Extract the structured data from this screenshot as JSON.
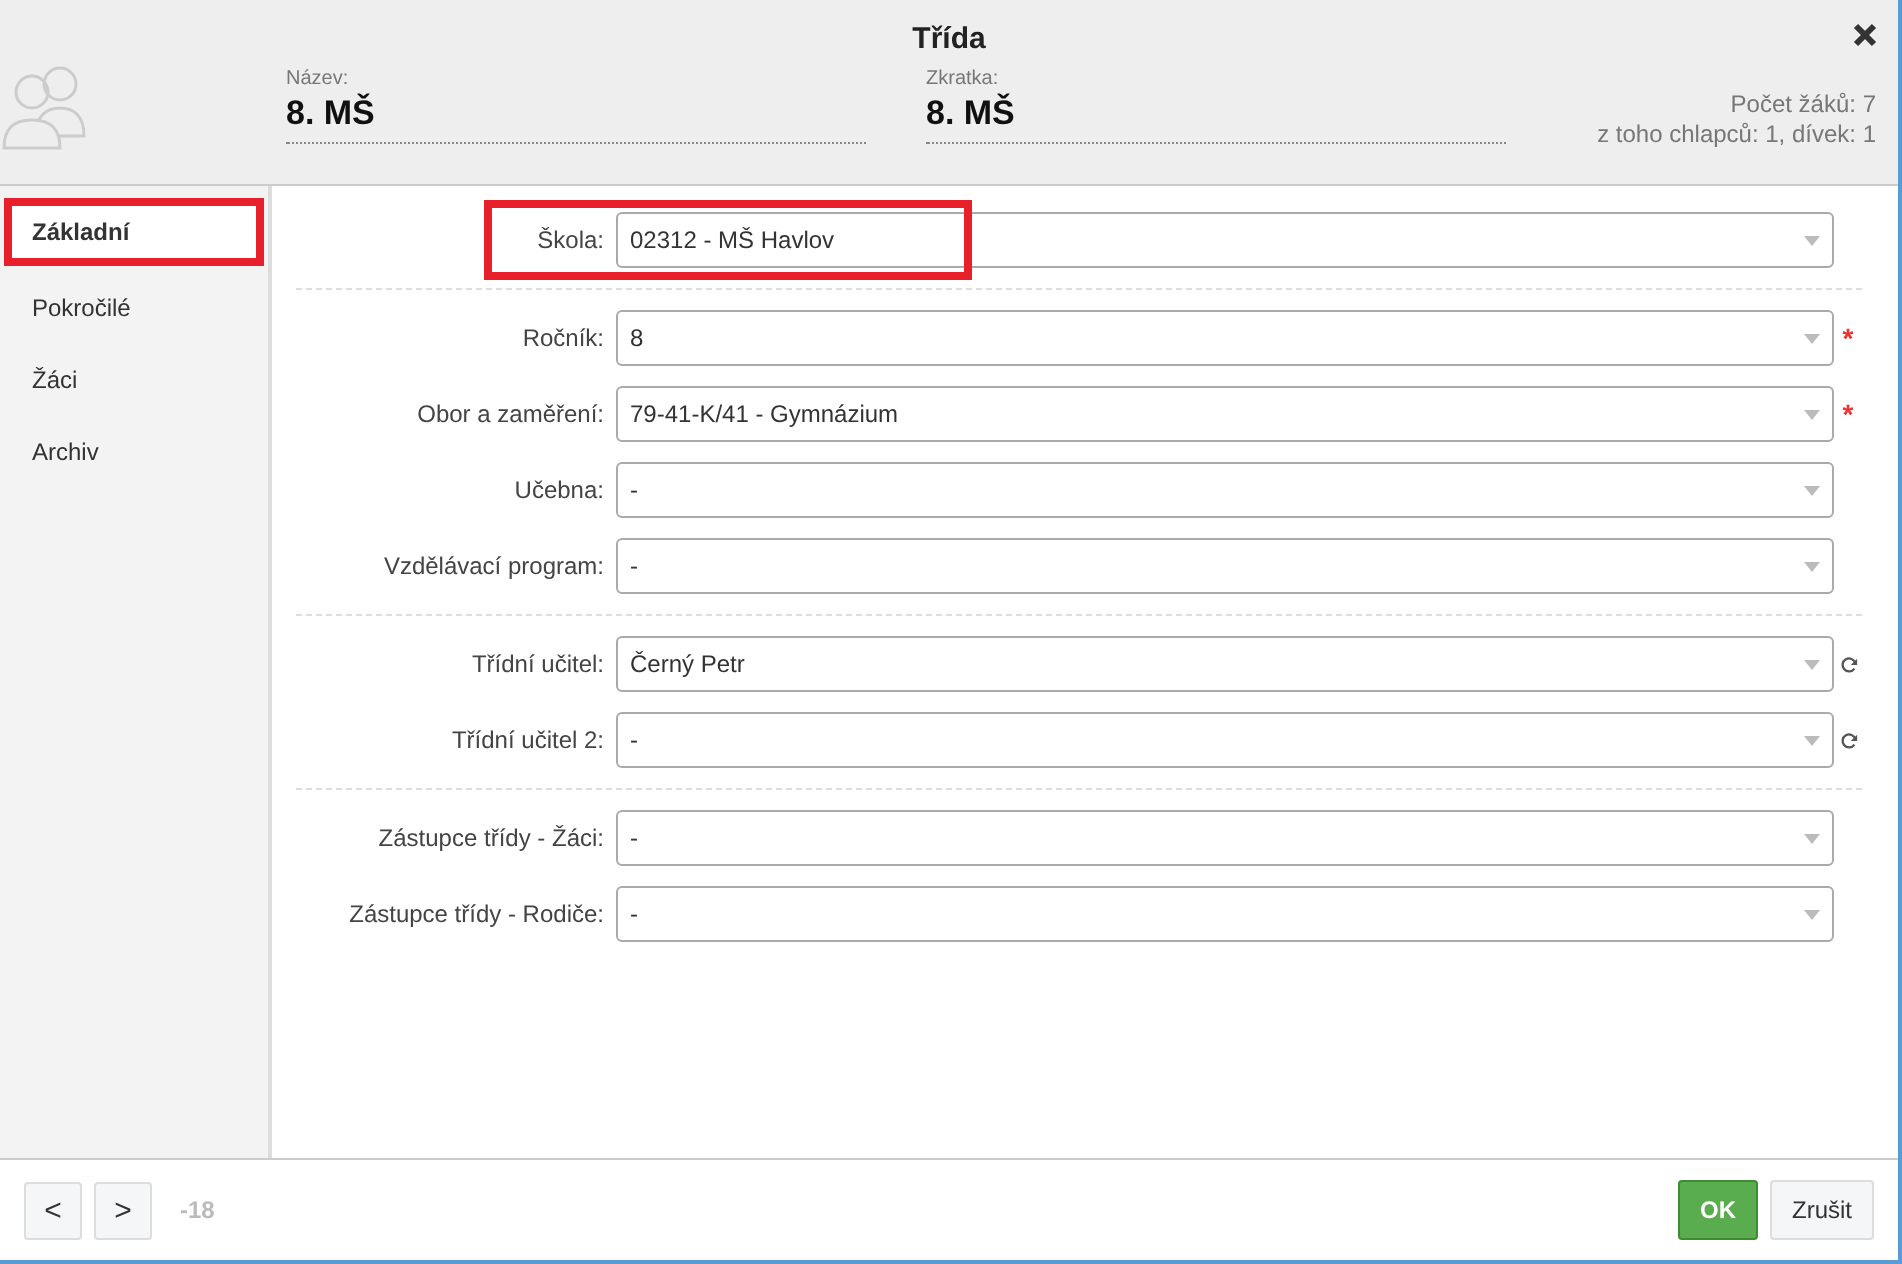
{
  "window": {
    "title": "Třída"
  },
  "header": {
    "fields": [
      {
        "label": "Název:",
        "value": "8. MŠ"
      },
      {
        "label": "Zkratka:",
        "value": "8. MŠ"
      }
    ],
    "stats": [
      "Počet žáků: 7",
      "z toho chlapců: 1, dívek: 1"
    ]
  },
  "sidebar": {
    "items": [
      {
        "label": "Základní",
        "selected": true,
        "highlighted": true
      },
      {
        "label": "Pokročilé",
        "selected": false,
        "highlighted": false
      },
      {
        "label": "Žáci",
        "selected": false,
        "highlighted": false
      },
      {
        "label": "Archiv",
        "selected": false,
        "highlighted": false
      }
    ]
  },
  "form": {
    "groups": [
      [
        {
          "label": "Škola:",
          "value": "02312 - MŠ Havlov",
          "highlighted": true
        }
      ],
      [
        {
          "label": "Ročník:",
          "value": "8",
          "required_mark": "*"
        },
        {
          "label": "Obor a zaměření:",
          "value": "79-41-K/41 - Gymnázium",
          "required_mark": "*"
        },
        {
          "label": "Učebna:",
          "value": "-"
        },
        {
          "label": "Vzdělávací program:",
          "value": "-"
        }
      ],
      [
        {
          "label": "Třídní učitel:",
          "value": "Černý Petr",
          "reloadable": true
        },
        {
          "label": "Třídní učitel 2:",
          "value": "-",
          "reloadable": true
        }
      ],
      [
        {
          "label": "Zástupce třídy - Žáci:",
          "value": "-"
        },
        {
          "label": "Zástupce třídy - Rodiče:",
          "value": "-"
        }
      ]
    ]
  },
  "footer": {
    "nav": [
      "<",
      ">"
    ],
    "record": "-18",
    "buttons": [
      {
        "label": "OK",
        "kind": "primary"
      },
      {
        "label": "Zrušit",
        "kind": "secondary"
      }
    ]
  }
}
